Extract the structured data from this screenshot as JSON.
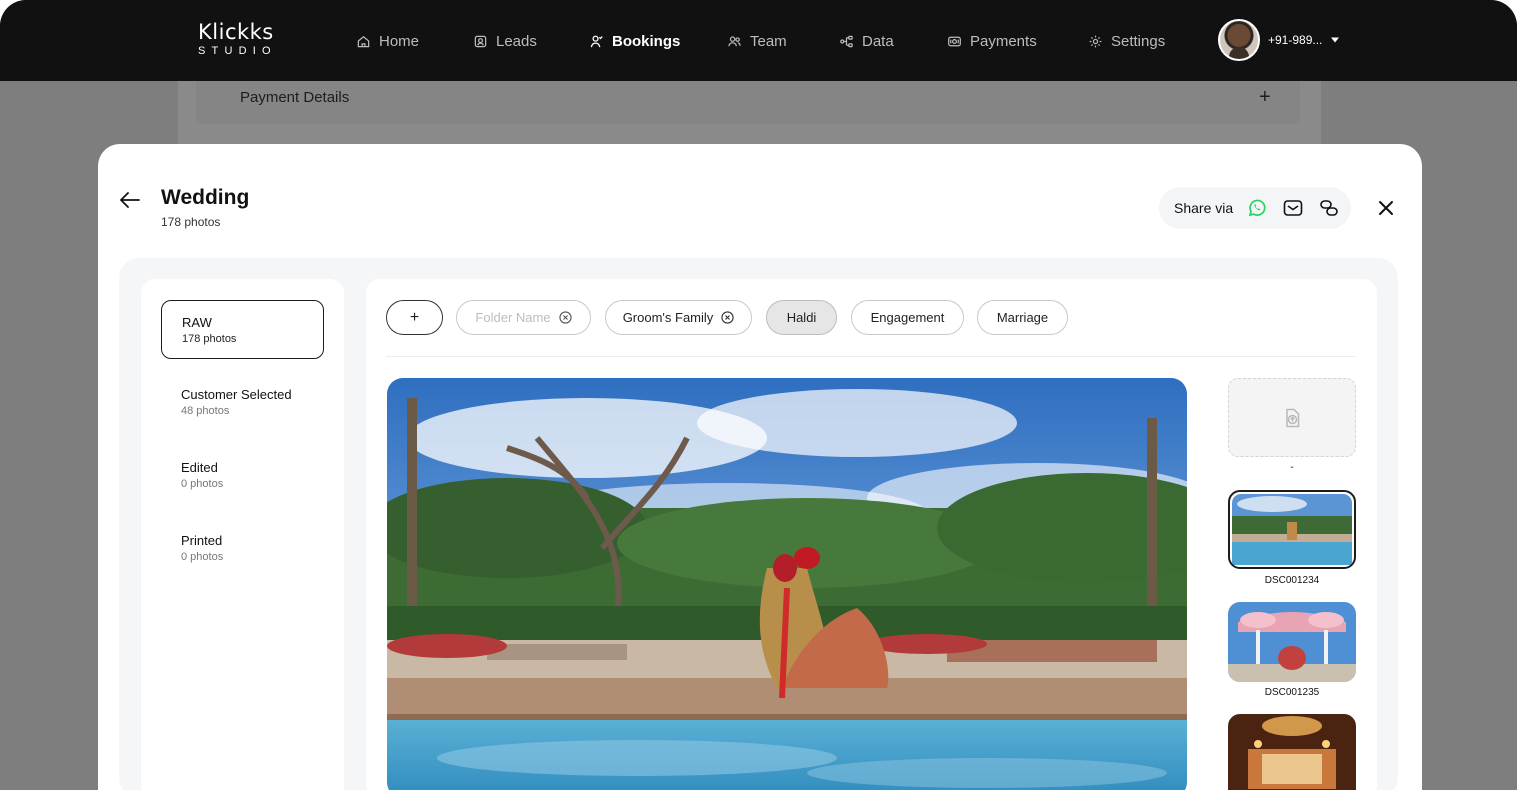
{
  "nav": {
    "brand": "Klickks",
    "brand_sub": "STUDIO",
    "items": [
      {
        "label": "Home",
        "icon": "home-icon"
      },
      {
        "label": "Leads",
        "icon": "leads-icon"
      },
      {
        "label": "Bookings",
        "icon": "bookings-icon",
        "active": true
      },
      {
        "label": "Team",
        "icon": "team-icon"
      },
      {
        "label": "Data",
        "icon": "data-icon"
      },
      {
        "label": "Payments",
        "icon": "payments-icon"
      },
      {
        "label": "Settings",
        "icon": "gear-icon"
      }
    ],
    "profile_phone": "+91-989..."
  },
  "background": {
    "section_title": "Payment Details",
    "expand_symbol": "+"
  },
  "modal": {
    "title": "Wedding",
    "subtitle": "178 photos",
    "share_label": "Share via",
    "share_icons": [
      "whatsapp-icon",
      "email-icon",
      "link-icon"
    ],
    "accent_whatsapp": "#25d366"
  },
  "folders": [
    {
      "name": "RAW",
      "count": "178 photos",
      "active": true
    },
    {
      "name": "Customer Selected",
      "count": "48 photos"
    },
    {
      "name": "Edited",
      "count": "0 photos"
    },
    {
      "name": "Printed",
      "count": "0 photos"
    }
  ],
  "chips": {
    "add_symbol": "+",
    "placeholder": "Folder Name",
    "items": [
      {
        "label": "Groom's Family",
        "removable": true
      },
      {
        "label": "Haldi",
        "selected": true
      },
      {
        "label": "Engagement"
      },
      {
        "label": "Marriage"
      }
    ]
  },
  "thumbnails": {
    "upload_label": "-",
    "items": [
      {
        "label": "DSC001234",
        "selected": true
      },
      {
        "label": "DSC001235"
      },
      {
        "label": ""
      }
    ]
  }
}
